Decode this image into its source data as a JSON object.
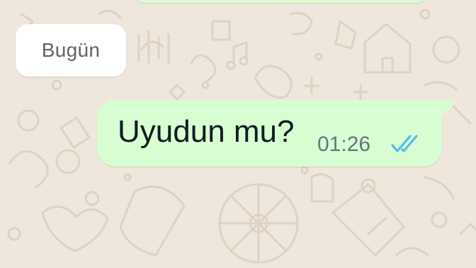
{
  "chat": {
    "date_label": "Bugün",
    "message": {
      "text": "Uyudun mu?",
      "time": "01:26",
      "status": "read",
      "status_icon": "double-check-icon"
    }
  },
  "colors": {
    "wallpaper": "#efe7dc",
    "wallpaper_doodle": "#d9cfc1",
    "outgoing_bubble": "#d9fdd3",
    "date_chip": "#ffffff",
    "read_tick": "#53bdeb",
    "time_text": "#667781",
    "message_text": "#111b21"
  }
}
